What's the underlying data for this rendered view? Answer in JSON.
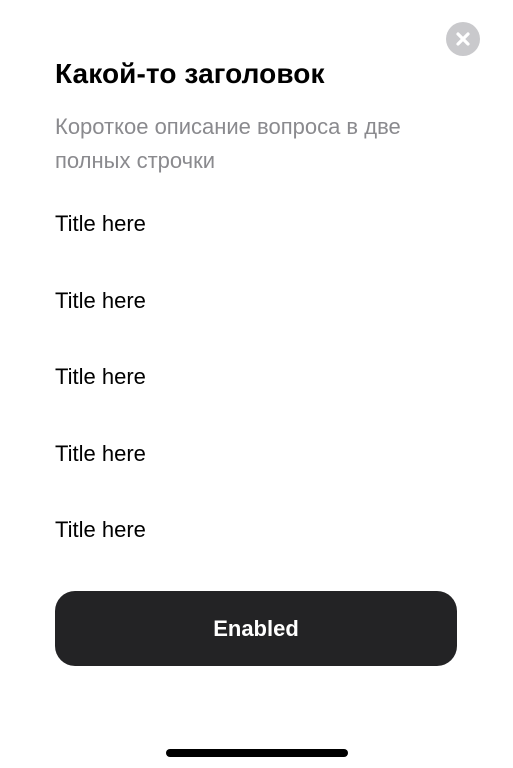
{
  "modal": {
    "close_icon": "close-icon",
    "title": "Какой-то заголовок",
    "subtitle": "Короткое описание вопроса в две полных строчки"
  },
  "options": [
    {
      "label": "Title here"
    },
    {
      "label": "Title here"
    },
    {
      "label": "Title here"
    },
    {
      "label": "Title here"
    },
    {
      "label": "Title here"
    }
  ],
  "button": {
    "label": "Enabled"
  },
  "colors": {
    "background": "#ffffff",
    "title": "#000000",
    "subtitle": "#8a8a8e",
    "button_bg": "#232325",
    "button_text": "#ffffff",
    "close_bg": "#c9c9cc"
  }
}
